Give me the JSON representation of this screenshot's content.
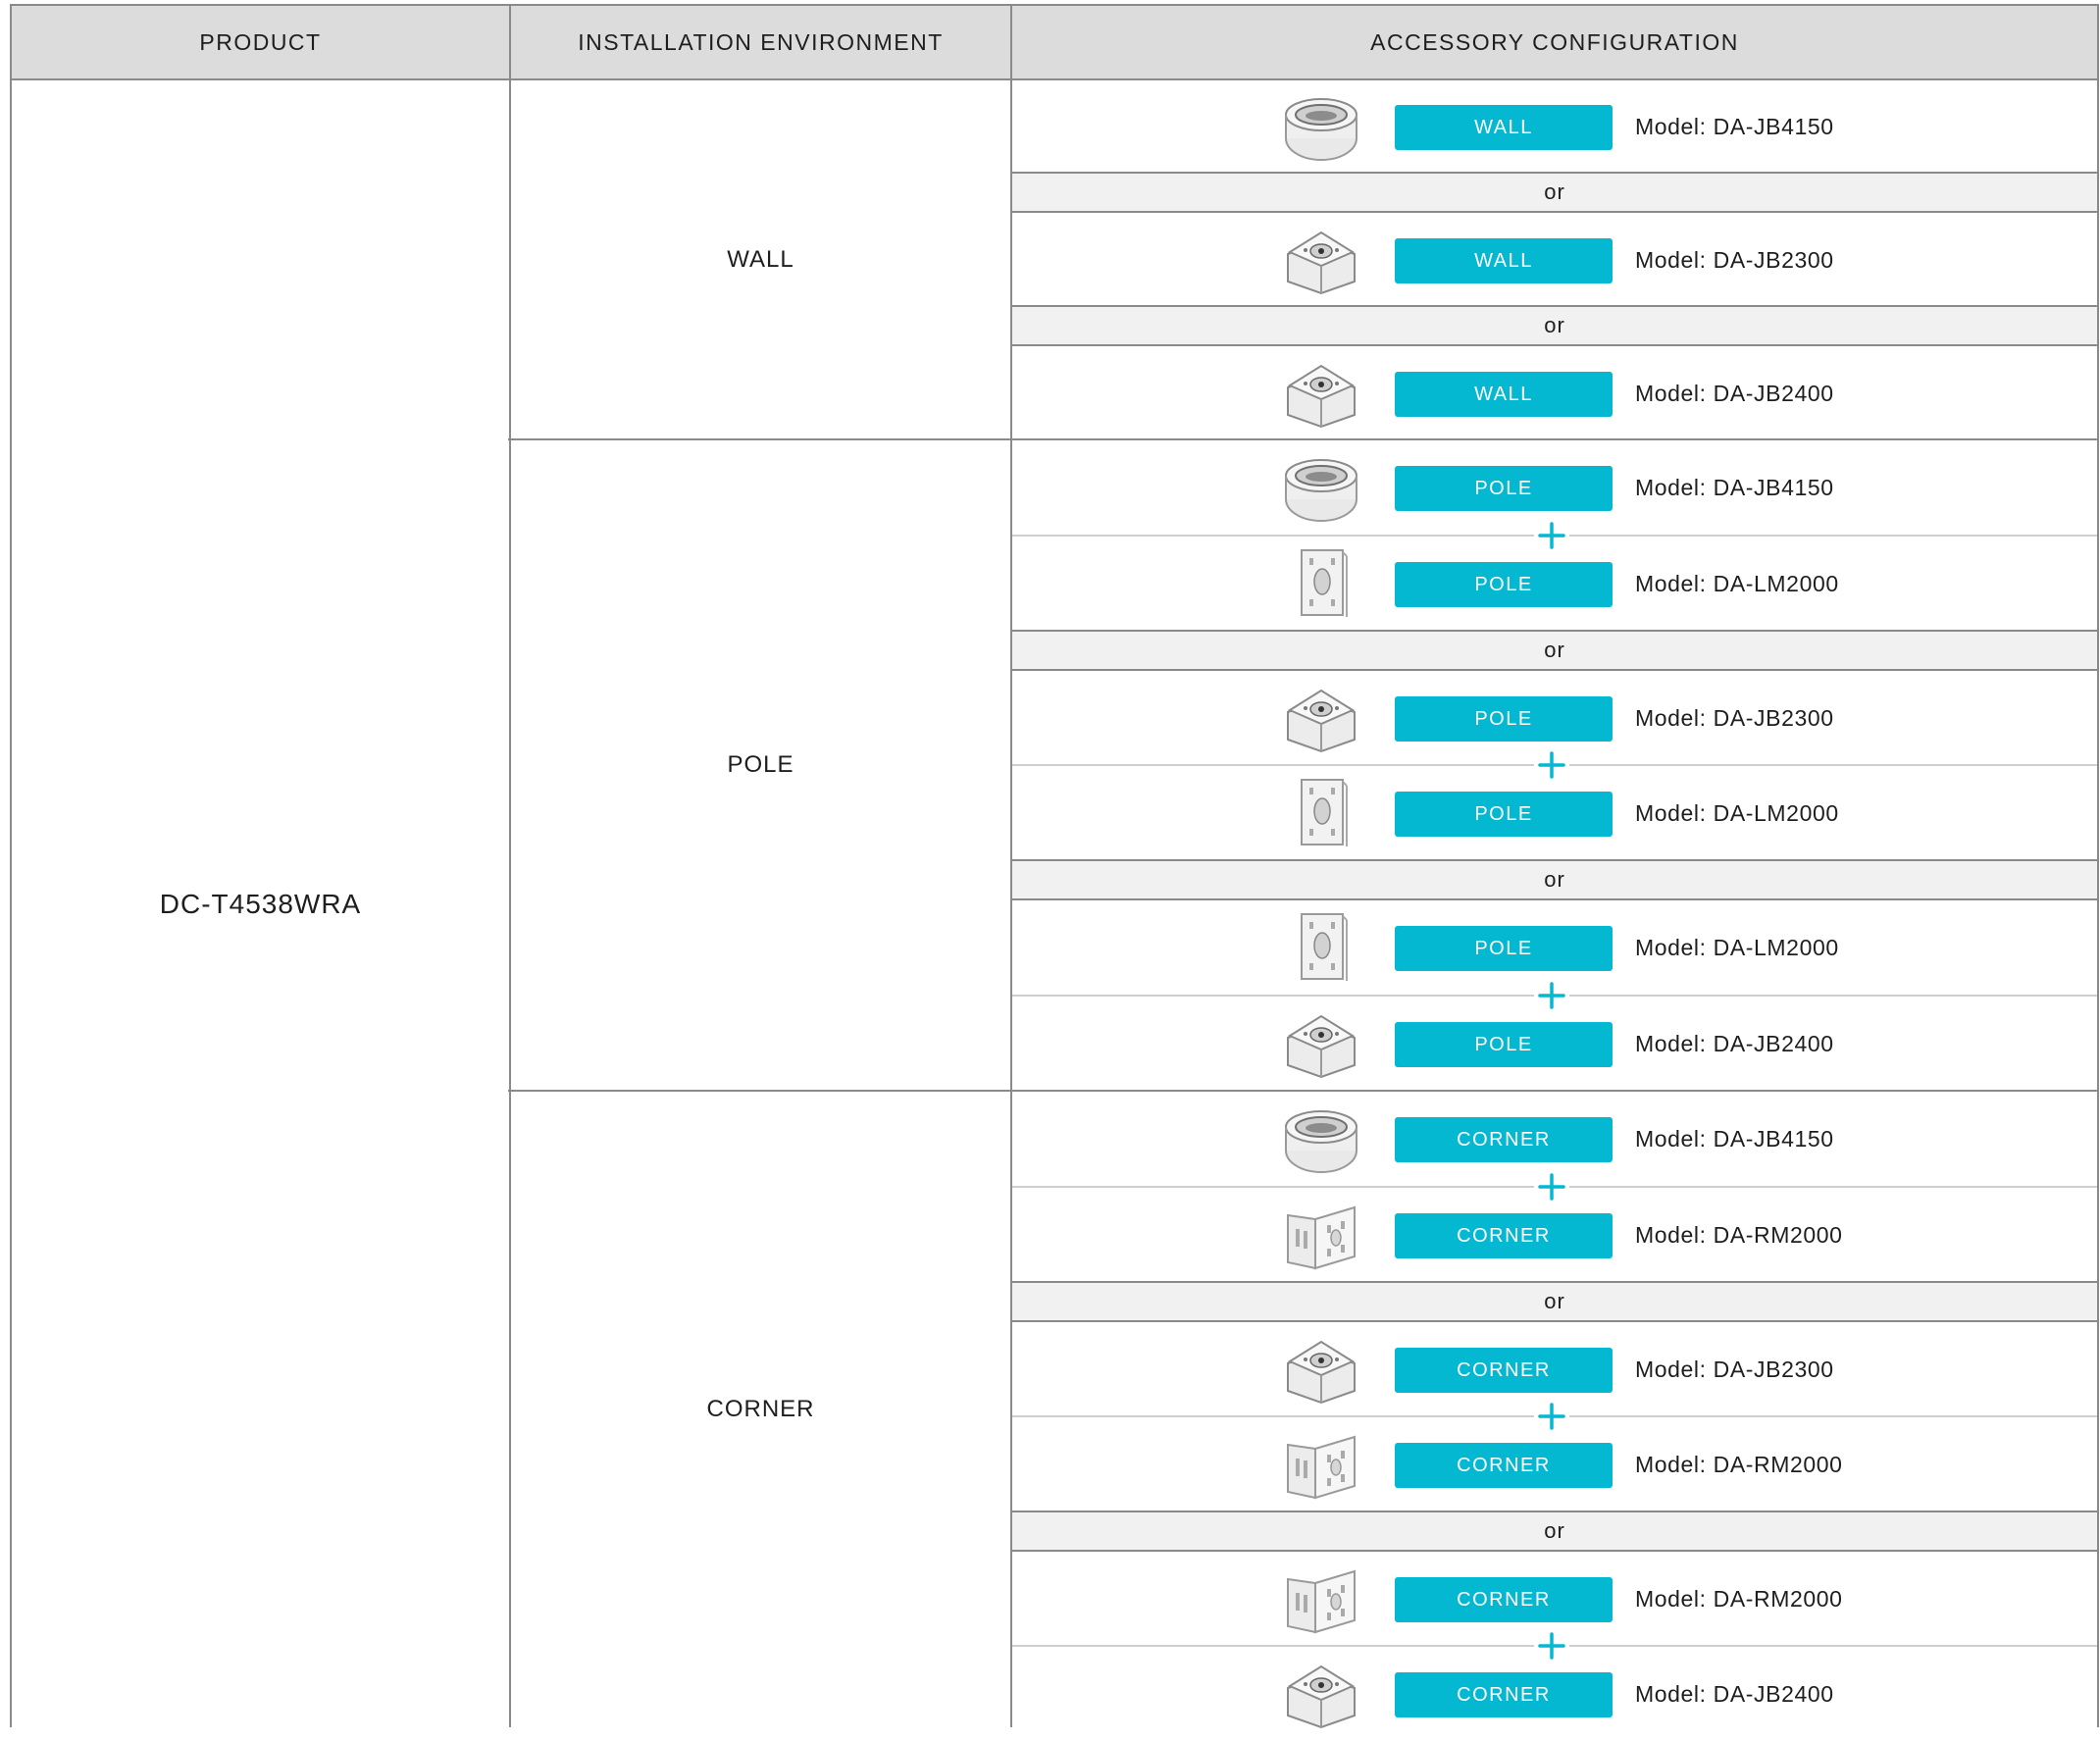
{
  "headers": {
    "product": "PRODUCT",
    "environment": "INSTALLATION ENVIRONMENT",
    "accessory": "ACCESSORY CONFIGURATION"
  },
  "product": "DC-T4538WRA",
  "environments": {
    "wall": "WALL",
    "pole": "POLE",
    "corner": "CORNER"
  },
  "or_label": "or",
  "accent_color": "#04b8d2",
  "accessories": [
    {
      "tag": "WALL",
      "model": "Model: DA-JB4150",
      "icon": "round-junction-box-icon"
    },
    {
      "tag": "WALL",
      "model": "Model: DA-JB2300",
      "icon": "square-junction-box-icon"
    },
    {
      "tag": "WALL",
      "model": "Model: DA-JB2400",
      "icon": "square-junction-box-icon"
    },
    {
      "tag": "POLE",
      "model": "Model: DA-JB4150",
      "icon": "round-junction-box-icon"
    },
    {
      "tag": "POLE",
      "model": "Model: DA-LM2000",
      "icon": "pole-mount-plate-icon"
    },
    {
      "tag": "POLE",
      "model": "Model: DA-JB2300",
      "icon": "square-junction-box-icon"
    },
    {
      "tag": "POLE",
      "model": "Model: DA-LM2000",
      "icon": "pole-mount-plate-icon"
    },
    {
      "tag": "POLE",
      "model": "Model: DA-LM2000",
      "icon": "pole-mount-plate-icon"
    },
    {
      "tag": "POLE",
      "model": "Model: DA-JB2400",
      "icon": "square-junction-box-icon"
    },
    {
      "tag": "CORNER",
      "model": "Model: DA-JB4150",
      "icon": "round-junction-box-icon"
    },
    {
      "tag": "CORNER",
      "model": "Model: DA-RM2000",
      "icon": "corner-mount-bracket-icon"
    },
    {
      "tag": "CORNER",
      "model": "Model: DA-JB2300",
      "icon": "square-junction-box-icon"
    },
    {
      "tag": "CORNER",
      "model": "Model: DA-RM2000",
      "icon": "corner-mount-bracket-icon"
    },
    {
      "tag": "CORNER",
      "model": "Model: DA-RM2000",
      "icon": "corner-mount-bracket-icon"
    },
    {
      "tag": "CORNER",
      "model": "Model: DA-JB2400",
      "icon": "square-junction-box-icon"
    }
  ]
}
